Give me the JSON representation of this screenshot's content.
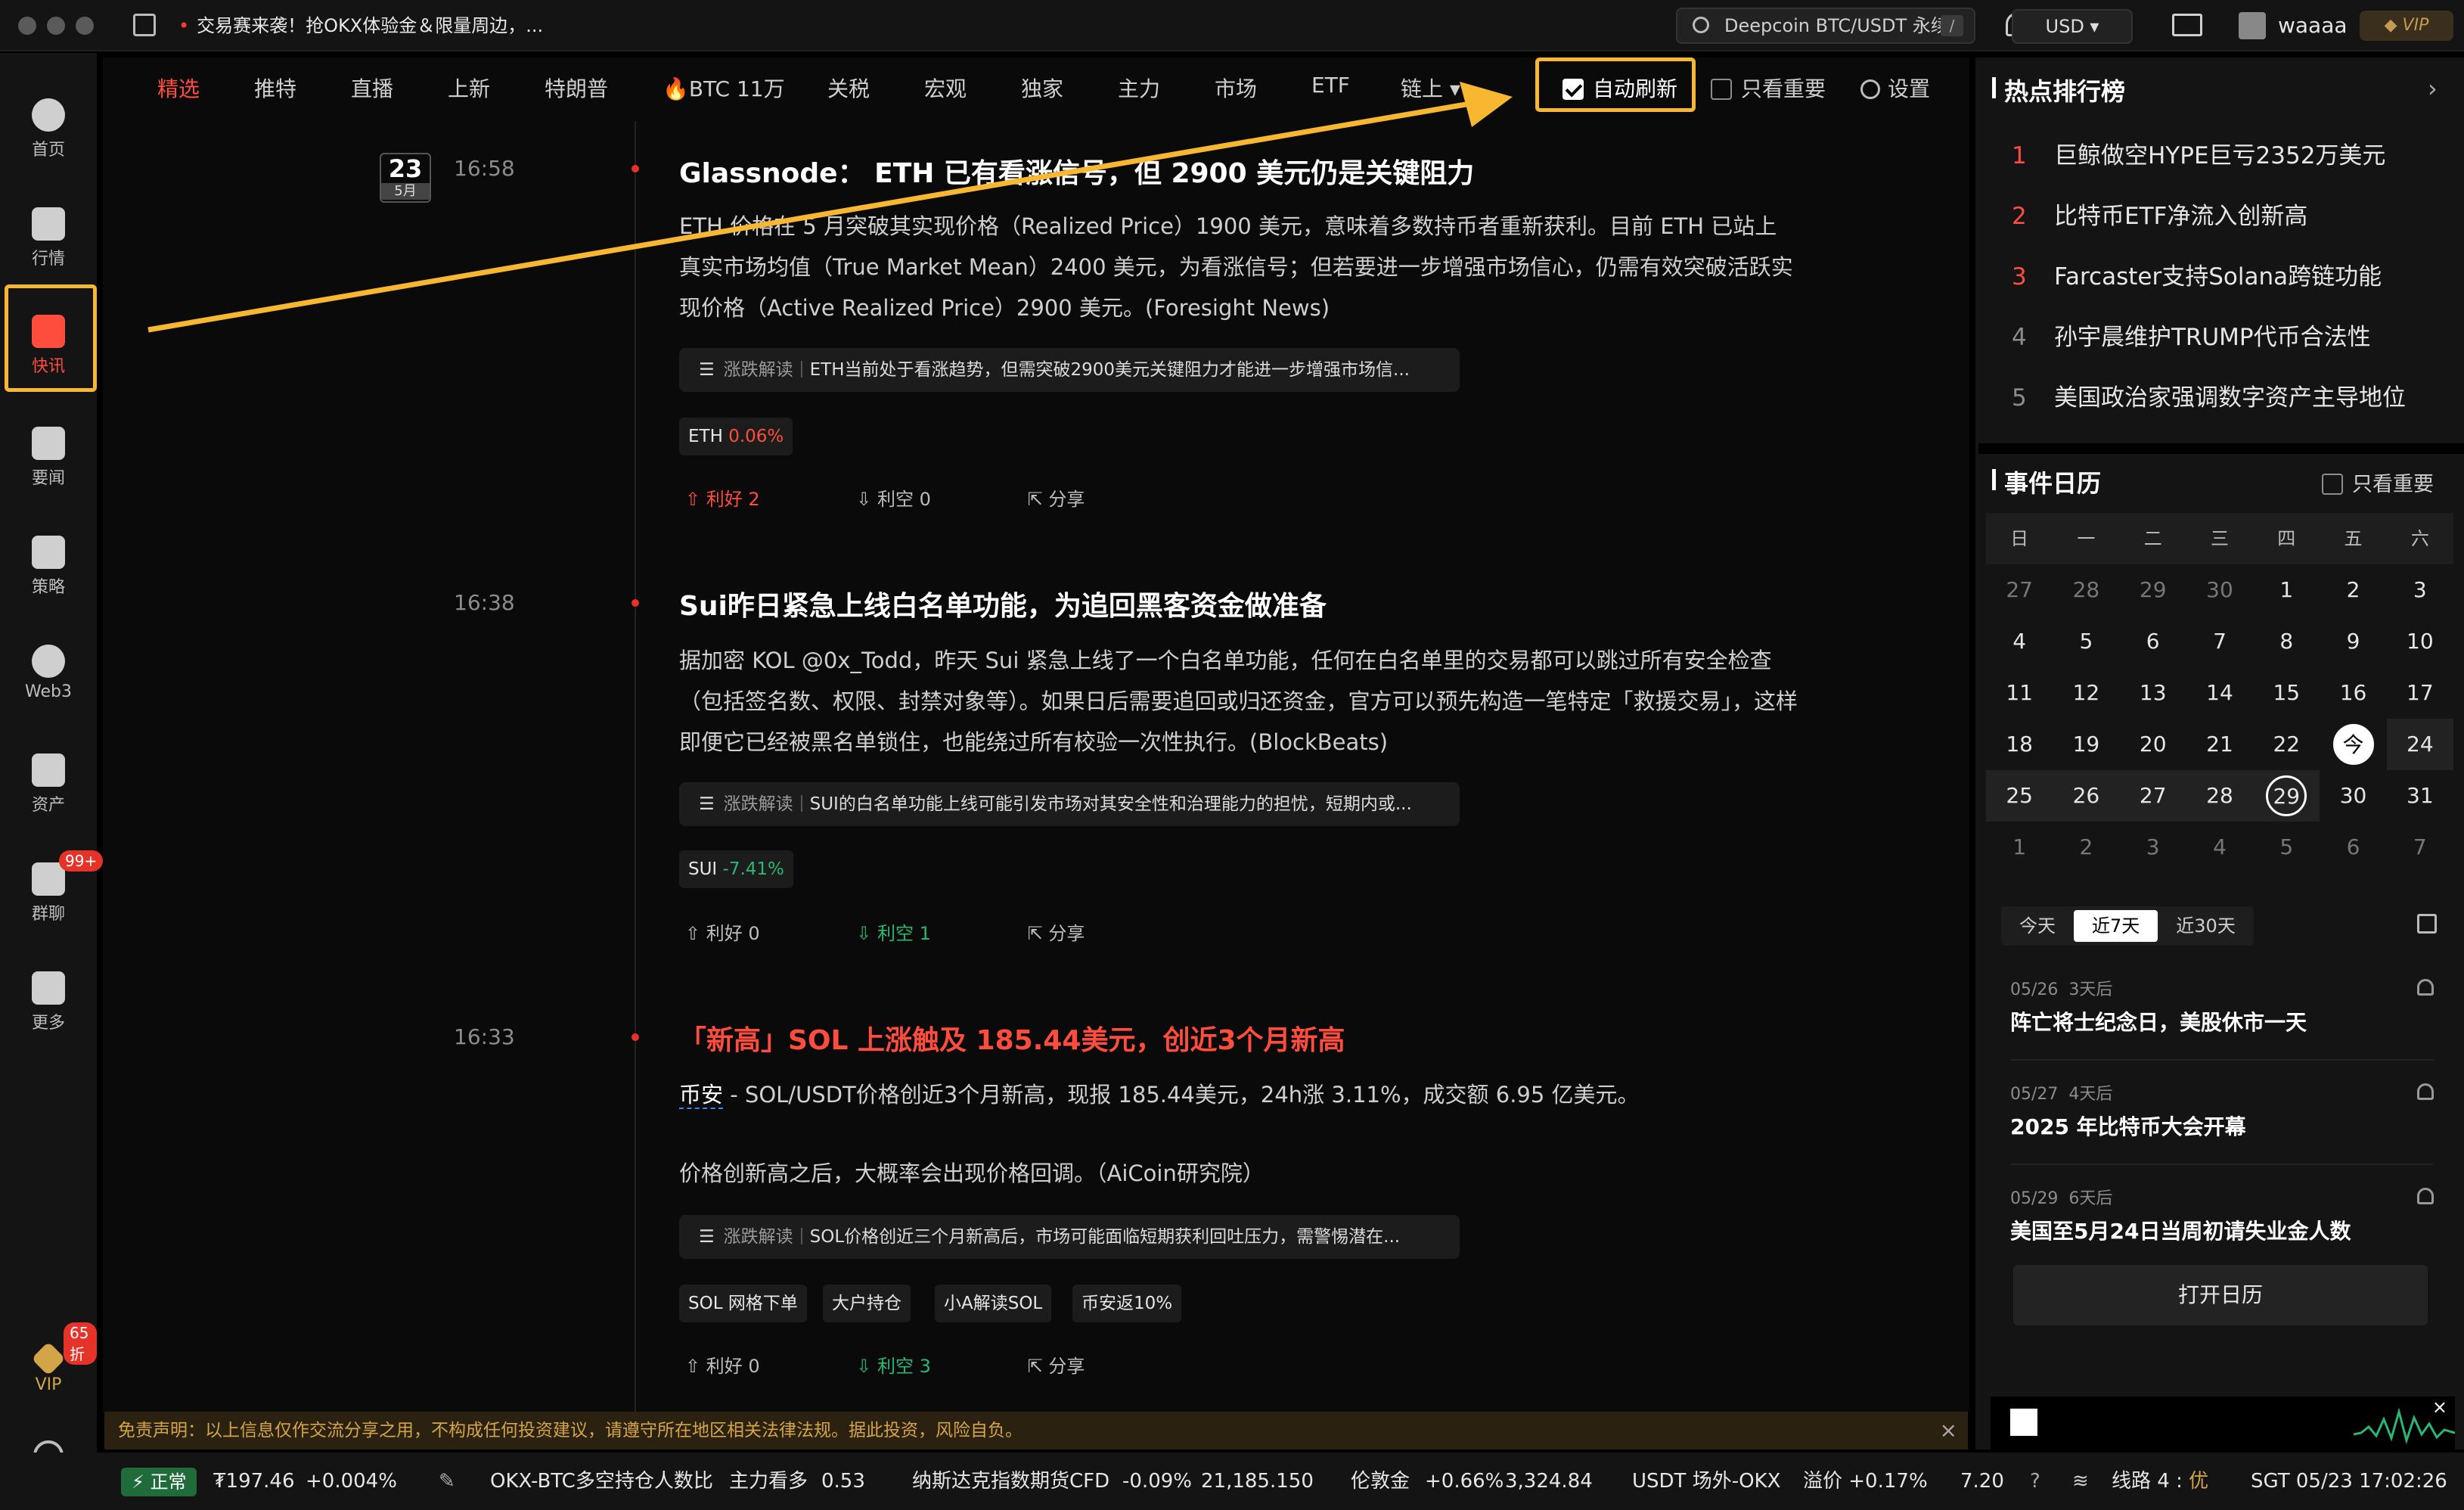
{
  "titlebar": {
    "promo": "交易赛来袭！抢OKX体验金＆限量周边，...",
    "search_text": "Deepcoin BTC/USDT 永续",
    "search_shortcut": "/",
    "currency": "USD",
    "username": "waaaa",
    "vip": "VIP"
  },
  "sidebar": {
    "items": [
      {
        "label": "首页",
        "icon": "home-icon"
      },
      {
        "label": "行情",
        "icon": "chart-icon"
      },
      {
        "label": "快讯",
        "icon": "news-flash-icon"
      },
      {
        "label": "要闻",
        "icon": "document-icon"
      },
      {
        "label": "策略",
        "icon": "robot-icon"
      },
      {
        "label": "Web3",
        "icon": "web3-icon"
      },
      {
        "label": "资产",
        "icon": "wallet-icon"
      },
      {
        "label": "群聊",
        "icon": "chat-icon"
      },
      {
        "label": "更多",
        "icon": "grid-icon"
      }
    ],
    "chat_badge": "99+",
    "vip_label": "VIP",
    "vip_badge": "65折"
  },
  "tabs": [
    "精选",
    "推特",
    "直播",
    "上新",
    "特朗普",
    "🔥BTC 11万",
    "关税",
    "宏观",
    "独家",
    "主力",
    "市场",
    "ETF",
    "链上 ▾"
  ],
  "toolbar": {
    "auto_refresh": "自动刷新",
    "important_only": "只看重要",
    "settings": "设置"
  },
  "feed": {
    "date_day": "23",
    "date_month": "5月",
    "items": [
      {
        "time": "16:58",
        "title": "Glassnode： ETH 已有看涨信号，但 2900 美元仍是关键阻力",
        "body": "ETH 价格在 5 月突破其实现价格（Realized Price）1900 美元，意味着多数持币者重新获利。目前 ETH 已站上真实市场均值（True Market Mean）2400 美元，为看涨信号；但若要进一步增强市场信心，仍需有效突破活跃实现价格（Active Realized Price）2900 美元。(Foresight News)",
        "interp_label": "涨跌解读",
        "interp": "ETH当前处于看涨趋势，但需突破2900美元关键阻力才能进一步增强市场信...",
        "chips": [
          {
            "name": "ETH",
            "change": "0.06%",
            "dir": "up"
          }
        ],
        "bull": "利好 2",
        "bear": "利空 0",
        "share": "分享"
      },
      {
        "time": "16:38",
        "title": "Sui昨日紧急上线白名单功能，为追回黑客资金做准备",
        "body": "据加密 KOL @0x_Todd，昨天 Sui 紧急上线了一个白名单功能，任何在白名单里的交易都可以跳过所有安全检查（包括签名数、权限、封禁对象等）。如果日后需要追回或归还资金，官方可以预先构造一笔特定「救援交易」，这样即便它已经被黑名单锁住，也能绕过所有校验一次性执行。(BlockBeats)",
        "interp_label": "涨跌解读",
        "interp": "SUI的白名单功能上线可能引发市场对其安全性和治理能力的担忧，短期内或...",
        "chips": [
          {
            "name": "SUI",
            "change": "-7.41%",
            "dir": "down"
          }
        ],
        "bull": "利好 0",
        "bear": "利空 1",
        "share": "分享"
      },
      {
        "time": "16:33",
        "title": "「新高」SOL 上涨触及 185.44美元，创近3个月新高",
        "source": "币安",
        "body": " - SOL/USDT价格创近3个月新高，现报 185.44美元，24h涨 3.11%，成交额 6.95 亿美元。",
        "body2": "价格创新高之后，大概率会出现价格回调。（AiCoin研究院）",
        "interp_label": "涨跌解读",
        "interp": "SOL价格创近三个月新高后，市场可能面临短期获利回吐压力，需警惕潜在...",
        "tags": [
          "SOL 网格下单",
          "大户持仓",
          "小A解读SOL",
          "币安返10%"
        ],
        "bull": "利好 0",
        "bear": "利空 3",
        "share": "分享"
      }
    ]
  },
  "disclaimer": "免责声明：以上信息仅作交流分享之用，不构成任何投资建议，请遵守所在地区相关法律法规。据此投资，风险自负。",
  "hot": {
    "title": "热点排行榜",
    "items": [
      {
        "rank": "1",
        "text": "巨鲸做空HYPE巨亏2352万美元"
      },
      {
        "rank": "2",
        "text": "比特币ETF净流入创新高"
      },
      {
        "rank": "3",
        "text": "Farcaster支持Solana跨链功能"
      },
      {
        "rank": "4",
        "text": "孙宇晨维护TRUMP代币合法性"
      },
      {
        "rank": "5",
        "text": "美国政治家强调数字资产主导地位"
      }
    ]
  },
  "calendar": {
    "title": "事件日历",
    "important_only": "只看重要",
    "weekdays": [
      "日",
      "一",
      "二",
      "三",
      "四",
      "五",
      "六"
    ],
    "weeks": [
      [
        "27",
        "28",
        "29",
        "30",
        "1",
        "2",
        "3"
      ],
      [
        "4",
        "5",
        "6",
        "7",
        "8",
        "9",
        "10"
      ],
      [
        "11",
        "12",
        "13",
        "14",
        "15",
        "16",
        "17"
      ],
      [
        "18",
        "19",
        "20",
        "21",
        "22",
        "今",
        "24"
      ],
      [
        "25",
        "26",
        "27",
        "28",
        "29",
        "30",
        "31"
      ],
      [
        "1",
        "2",
        "3",
        "4",
        "5",
        "6",
        "7"
      ]
    ],
    "periods": [
      "今天",
      "近7天",
      "近30天"
    ],
    "events": [
      {
        "date": "05/26",
        "rel": "3天后",
        "title": "阵亡将士纪念日，美股休市一天"
      },
      {
        "date": "05/27",
        "rel": "4天后",
        "title": "2025 年比特币大会开幕"
      },
      {
        "date": "05/29",
        "rel": "6天后",
        "title": "美国至5月24日当周初请失业金人数"
      }
    ],
    "open_button": "打开日历"
  },
  "status": {
    "state": "正常",
    "price": "₮197.46",
    "price_change": "+0.004%",
    "t1_name": "OKX-BTC多空持仓人数比",
    "t1_tag": "主力看多",
    "t1_val": "0.53",
    "t2_name": "纳斯达克指数期货CFD",
    "t2_change": "-0.09%",
    "t2_val": "21,185.150",
    "t3_name": "伦敦金",
    "t3_change": "+0.66%",
    "t3_val": "3,324.84",
    "t4_name": "USDT 场外-OKX",
    "t4_tag": "溢价 +0.17%",
    "t4_val": "7.20",
    "line": "线路 4 :",
    "line_quality": "优",
    "clock": "SGT 05/23 17:02:26"
  },
  "colors": {
    "up": "#ff4d3d",
    "down": "#2bb673",
    "highlight": "#f7b731"
  }
}
